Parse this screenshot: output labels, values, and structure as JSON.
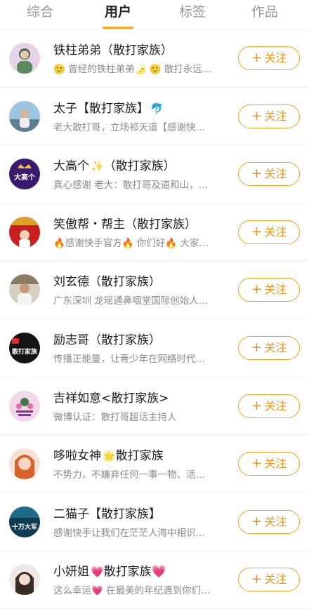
{
  "tabs": [
    {
      "label": "综合"
    },
    {
      "label": "用户"
    },
    {
      "label": "标签"
    },
    {
      "label": "作品"
    }
  ],
  "follow_label": "关注",
  "follow_plus": "+",
  "accent_color": "#f0a21e",
  "users": [
    {
      "name": "铁柱弟弟（散打家族）",
      "name_emoji": "",
      "desc": "🙂 曾经的铁柱弟弟🌛 🙂 散打永远…"
    },
    {
      "name": "太子【散打家族】",
      "name_emoji": "🐬",
      "desc": "老大散打哥，立场祁天道【感谢快…"
    },
    {
      "name": "大高个",
      "name_emoji": "✨",
      "name_suffix": "（散打家族）",
      "desc": "真心感谢 老大：散打哥及道和山，…",
      "avatar_text": "大高个"
    },
    {
      "name": "笑傲帮・帮主（散打家族）",
      "name_emoji": "",
      "desc": "🔥感谢快手官方🔥 你们好🔥 大家…"
    },
    {
      "name": "刘玄德（散打家族）",
      "name_emoji": "",
      "desc": "广东深圳 龙瑶通鼻咽堂国际创始人…"
    },
    {
      "name": "励志哥（散打家族）",
      "name_emoji": "",
      "desc": "传播正能量，让青少年在网络时代…",
      "avatar_text": "散打家族"
    },
    {
      "name": "吉祥如意<散打家族>",
      "name_emoji": "",
      "desc": "微博认证：散打哥超话主持人"
    },
    {
      "name": "哆啦女神",
      "name_emoji": "🌟",
      "name_suffix": "散打家族",
      "desc": "不势力，不嫌弃任何一事一物、活…"
    },
    {
      "name": "二猫子【散打家族】",
      "name_emoji": "",
      "desc": "感谢快手让我们在茫茫人海中相识…",
      "avatar_text": "十万大军"
    },
    {
      "name": "小妍姐",
      "name_emoji": "💗",
      "name_suffix": "散打家族💗",
      "desc": "这么幸运💗 在最美的年纪遇到你们…"
    }
  ]
}
